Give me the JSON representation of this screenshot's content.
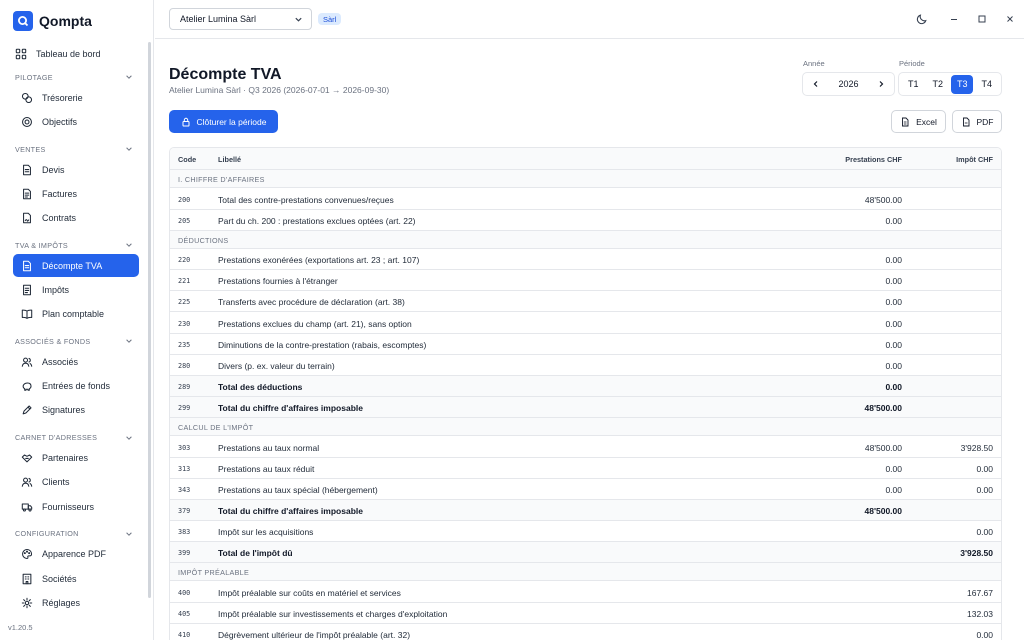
{
  "app": {
    "name": "Qompta",
    "version": "v1.20.5"
  },
  "sidebar": {
    "top": [
      {
        "key": "dashboard",
        "label": "Tableau de bord",
        "icon": "dashboard-icon"
      }
    ],
    "sections": [
      {
        "title": "PILOTAGE",
        "items": [
          {
            "label": "Trésorerie",
            "icon": "coins-icon"
          },
          {
            "label": "Objectifs",
            "icon": "target-icon"
          }
        ]
      },
      {
        "title": "VENTES",
        "items": [
          {
            "label": "Devis",
            "icon": "document-icon"
          },
          {
            "label": "Factures",
            "icon": "invoice-icon"
          },
          {
            "label": "Contrats",
            "icon": "contract-icon"
          }
        ]
      },
      {
        "title": "TVA & IMPÔTS",
        "items": [
          {
            "label": "Décompte TVA",
            "icon": "document-icon",
            "active": true
          },
          {
            "label": "Impôts",
            "icon": "tax-icon"
          },
          {
            "label": "Plan comptable",
            "icon": "book-icon"
          }
        ]
      },
      {
        "title": "ASSOCIÉS & FONDS",
        "items": [
          {
            "label": "Associés",
            "icon": "users-icon"
          },
          {
            "label": "Entrées de fonds",
            "icon": "piggy-icon"
          },
          {
            "label": "Signatures",
            "icon": "pen-icon"
          }
        ]
      },
      {
        "title": "CARNET D'ADRESSES",
        "items": [
          {
            "label": "Partenaires",
            "icon": "handshake-icon"
          },
          {
            "label": "Clients",
            "icon": "users-icon"
          },
          {
            "label": "Fournisseurs",
            "icon": "truck-icon"
          }
        ]
      },
      {
        "title": "CONFIGURATION",
        "items": [
          {
            "label": "Apparence PDF",
            "icon": "palette-icon"
          },
          {
            "label": "Sociétés",
            "icon": "building-icon"
          },
          {
            "label": "Réglages",
            "icon": "gear-icon"
          }
        ]
      }
    ]
  },
  "topbar": {
    "company": "Atelier Lumina Sàrl",
    "company_type": "Sàrl"
  },
  "page": {
    "title": "Décompte TVA",
    "subtitle": "Atelier Lumina Sàrl · Q3 2026 (2026-07-01 → 2026-09-30)",
    "year_label": "Année",
    "year": "2026",
    "period_label": "Période",
    "periods": [
      {
        "label": "T1"
      },
      {
        "label": "T2"
      },
      {
        "label": "T3",
        "active": true
      },
      {
        "label": "T4"
      }
    ],
    "close_label": "Clôturer la période",
    "excel_label": "Excel",
    "pdf_label": "PDF"
  },
  "table": {
    "headers": {
      "code": "Code",
      "label": "Libellé",
      "prest": "Prestations CHF",
      "imp": "Impôt CHF"
    },
    "rows": [
      {
        "type": "section",
        "label": "I. CHIFFRE D'AFFAIRES"
      },
      {
        "code": "200",
        "label": "Total des contre-prestations convenues/reçues",
        "prest": "48'500.00",
        "imp": ""
      },
      {
        "code": "205",
        "label": "Part du ch. 200 : prestations exclues optées (art. 22)",
        "prest": "0.00",
        "imp": ""
      },
      {
        "type": "section",
        "label": "DÉDUCTIONS"
      },
      {
        "code": "220",
        "label": "Prestations exonérées (exportations art. 23 ; art. 107)",
        "prest": "0.00",
        "imp": ""
      },
      {
        "code": "221",
        "label": "Prestations fournies à l'étranger",
        "prest": "0.00",
        "imp": ""
      },
      {
        "code": "225",
        "label": "Transferts avec procédure de déclaration (art. 38)",
        "prest": "0.00",
        "imp": ""
      },
      {
        "code": "230",
        "label": "Prestations exclues du champ (art. 21), sans option",
        "prest": "0.00",
        "imp": ""
      },
      {
        "code": "235",
        "label": "Diminutions de la contre-prestation (rabais, escomptes)",
        "prest": "0.00",
        "imp": ""
      },
      {
        "code": "280",
        "label": "Divers (p. ex. valeur du terrain)",
        "prest": "0.00",
        "imp": ""
      },
      {
        "code": "289",
        "label": "Total des déductions",
        "prest": "0.00",
        "imp": "",
        "bold": true
      },
      {
        "code": "299",
        "label": "Total du chiffre d'affaires imposable",
        "prest": "48'500.00",
        "imp": "",
        "bold": true
      },
      {
        "type": "section",
        "label": "CALCUL DE L'IMPÔT"
      },
      {
        "code": "303",
        "label": "Prestations au taux normal",
        "prest": "48'500.00",
        "imp": "3'928.50"
      },
      {
        "code": "313",
        "label": "Prestations au taux réduit",
        "prest": "0.00",
        "imp": "0.00"
      },
      {
        "code": "343",
        "label": "Prestations au taux spécial (hébergement)",
        "prest": "0.00",
        "imp": "0.00"
      },
      {
        "code": "379",
        "label": "Total du chiffre d'affaires imposable",
        "prest": "48'500.00",
        "imp": "",
        "bold": true
      },
      {
        "code": "383",
        "label": "Impôt sur les acquisitions",
        "prest": "",
        "imp": "0.00"
      },
      {
        "code": "399",
        "label": "Total de l'impôt dû",
        "prest": "",
        "imp": "3'928.50",
        "bold": true
      },
      {
        "type": "section",
        "label": "IMPÔT PRÉALABLE"
      },
      {
        "code": "400",
        "label": "Impôt préalable sur coûts en matériel et services",
        "prest": "",
        "imp": "167.67"
      },
      {
        "code": "405",
        "label": "Impôt préalable sur investissements et charges d'exploitation",
        "prest": "",
        "imp": "132.03"
      },
      {
        "code": "410",
        "label": "Dégrèvement ultérieur de l'impôt préalable (art. 32)",
        "prest": "",
        "imp": "0.00"
      }
    ]
  },
  "colors": {
    "accent": "#2563eb",
    "border": "#e5e7eb",
    "muted": "#6b7280",
    "badge_bg": "#dbeafe"
  }
}
